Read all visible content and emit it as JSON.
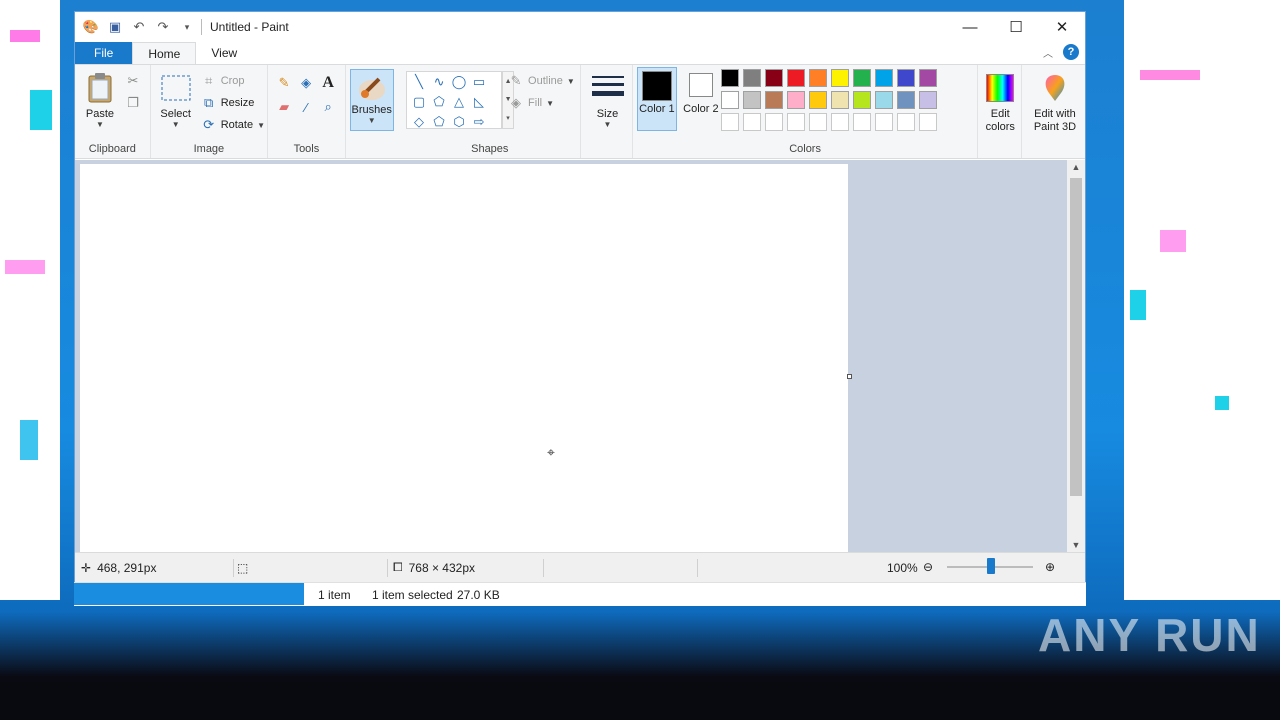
{
  "window": {
    "title": "Untitled - Paint",
    "controls": {
      "minimize": "—",
      "maximize": "☐",
      "close": "✕"
    }
  },
  "tabs": {
    "file": "File",
    "home": "Home",
    "view": "View",
    "help": "?"
  },
  "ribbon": {
    "clipboard": {
      "label": "Clipboard",
      "paste": "Paste"
    },
    "image": {
      "label": "Image",
      "select": "Select",
      "crop": "Crop",
      "resize": "Resize",
      "rotate": "Rotate"
    },
    "tools": {
      "label": "Tools"
    },
    "brushes": {
      "label": "Brushes"
    },
    "shapes": {
      "label": "Shapes",
      "outline": "Outline",
      "fill": "Fill"
    },
    "size": {
      "label": "Size"
    },
    "colors": {
      "label": "Colors",
      "color1": "Color 1",
      "color2": "Color 2",
      "color1_value": "#000000",
      "color2_value": "#ffffff",
      "edit_colors": "Edit colors",
      "edit_paint3d": "Edit with Paint 3D",
      "palette": [
        "#000000",
        "#7f7f7f",
        "#880015",
        "#ed1c24",
        "#ff7f27",
        "#fff200",
        "#22b14c",
        "#00a2e8",
        "#3f48cc",
        "#a349a4",
        "#ffffff",
        "#c3c3c3",
        "#b97a57",
        "#ffaec9",
        "#ffc90e",
        "#efe4b0",
        "#b5e61d",
        "#99d9ea",
        "#7092be",
        "#c8bfe7",
        "#ffffff",
        "#ffffff",
        "#ffffff",
        "#ffffff",
        "#ffffff",
        "#ffffff",
        "#ffffff",
        "#ffffff",
        "#ffffff",
        "#ffffff"
      ]
    }
  },
  "status": {
    "cursor_pos": "468, 291px",
    "canvas_size": "768 × 432px",
    "zoom": "100%"
  },
  "explorer": {
    "items": "1 item",
    "selected": "1 item selected",
    "size": "27.0 KB"
  },
  "watermark": "ANY RUN"
}
